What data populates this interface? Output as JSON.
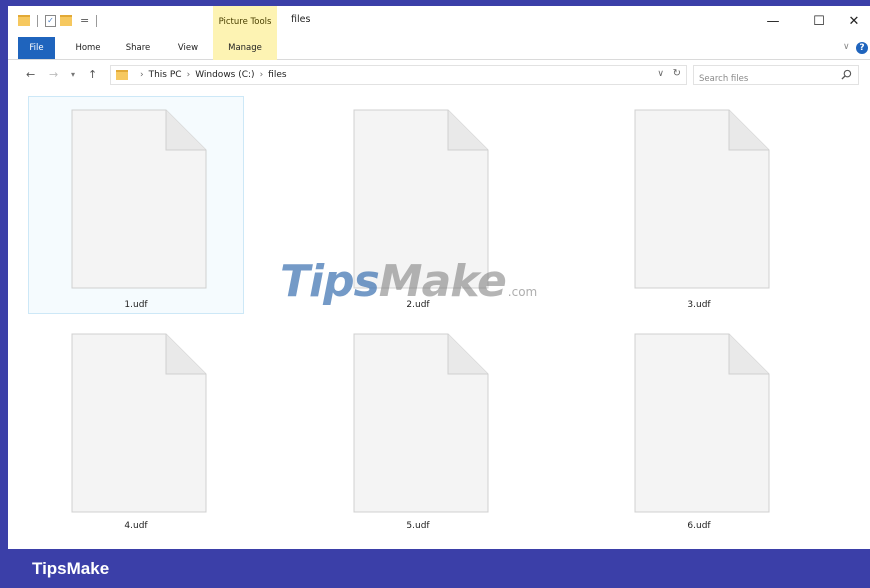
{
  "window": {
    "title": "files",
    "context_tab_group": "Picture Tools",
    "controls": {
      "minimize": "—",
      "maximize": "☐",
      "close": "✕"
    }
  },
  "ribbon": {
    "tabs": [
      {
        "label": "File",
        "active": true
      },
      {
        "label": "Home"
      },
      {
        "label": "Share"
      },
      {
        "label": "View"
      },
      {
        "label": "Manage",
        "contextual": true
      }
    ]
  },
  "address_bar": {
    "path": [
      "This PC",
      "Windows (C:)",
      "files"
    ],
    "search_placeholder": "Search files"
  },
  "files": [
    {
      "name": "1.udf",
      "selected": true
    },
    {
      "name": "2.udf"
    },
    {
      "name": "3.udf"
    },
    {
      "name": "4.udf"
    },
    {
      "name": "5.udf"
    },
    {
      "name": "6.udf"
    }
  ],
  "watermark": {
    "part1": "Tips",
    "part2": "Make",
    "suffix": ".com"
  },
  "footer": {
    "brand": "TipsMake"
  },
  "colors": {
    "frame": "#3b3fa8",
    "file_tab": "#1f64bd",
    "picture_tools": "#fdf3b3",
    "selection": "#cde8f7"
  }
}
